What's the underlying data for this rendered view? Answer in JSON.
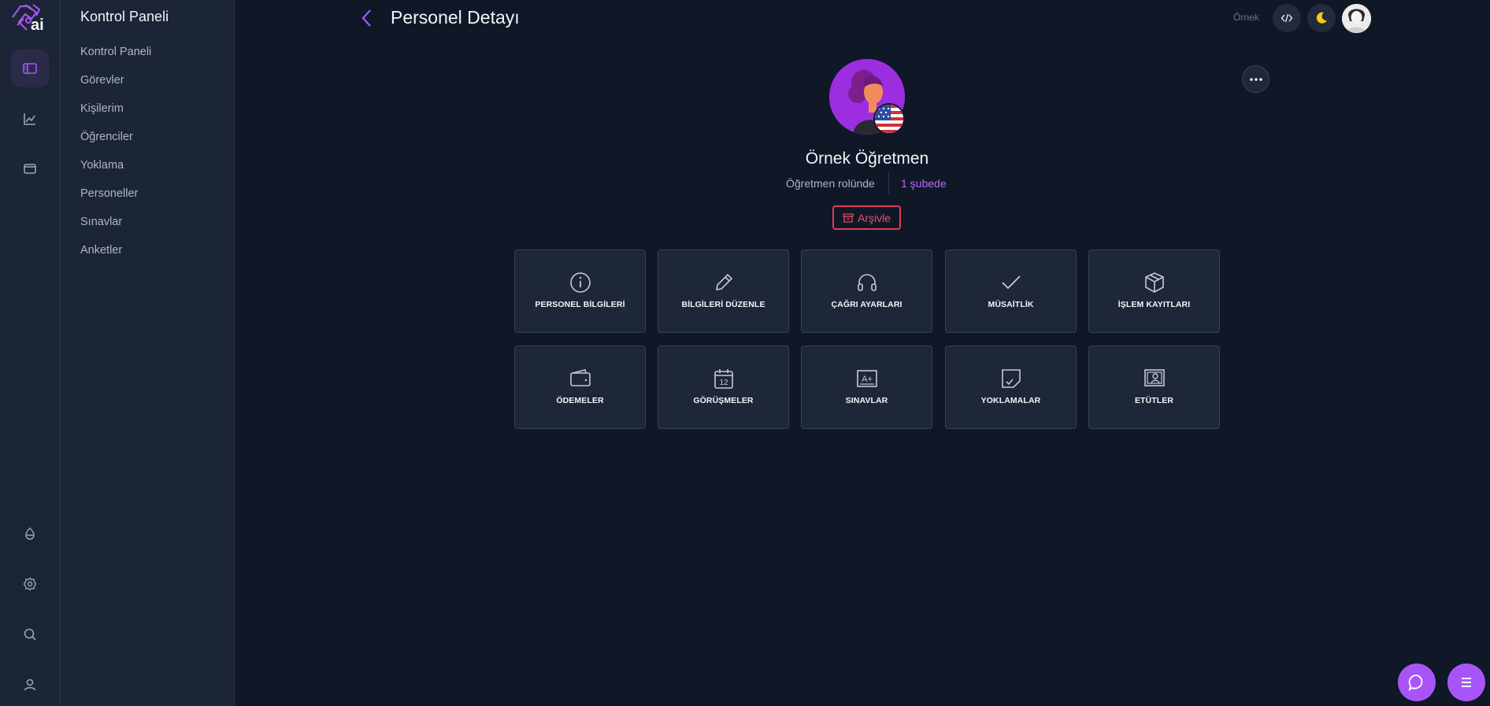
{
  "sidebar": {
    "title": "Kontrol Paneli",
    "items": [
      {
        "label": "Kontrol Paneli"
      },
      {
        "label": "Görevler"
      },
      {
        "label": "Kişilerim"
      },
      {
        "label": "Öğrenciler"
      },
      {
        "label": "Yoklama"
      },
      {
        "label": "Personeller"
      },
      {
        "label": "Sınavlar"
      },
      {
        "label": "Anketler"
      }
    ]
  },
  "rail": {
    "logo_text": "ai",
    "top_icons": [
      "sidebar-panel-icon",
      "chart-icon",
      "wallet-icon"
    ],
    "bottom_icons": [
      "theme-drop-icon",
      "settings-icon",
      "search-icon",
      "user-icon"
    ]
  },
  "header": {
    "title": "Personel Detayı",
    "user_name": "Örnek",
    "icons": [
      "code-icon",
      "moon-icon"
    ]
  },
  "profile": {
    "name": "Örnek Öğretmen",
    "role": "Öğretmen rolünde",
    "branch": "1 şubede",
    "archive_label": "Arşivle"
  },
  "cards": [
    {
      "label": "PERSONEL BİLGİLERİ",
      "icon": "info-icon"
    },
    {
      "label": "BİLGİLERİ DÜZENLE",
      "icon": "pencil-icon"
    },
    {
      "label": "ÇAĞRI AYARLARI",
      "icon": "headset-icon"
    },
    {
      "label": "MÜSAİTLİK",
      "icon": "check-icon"
    },
    {
      "label": "İŞLEM KAYITLARI",
      "icon": "box-icon"
    },
    {
      "label": "ÖDEMELER",
      "icon": "wallet-icon"
    },
    {
      "label": "GÖRÜŞMELER",
      "icon": "calendar-icon"
    },
    {
      "label": "SINAVLAR",
      "icon": "exam-icon"
    },
    {
      "label": "YOKLAMALAR",
      "icon": "attendance-icon"
    },
    {
      "label": "ETÜTLER",
      "icon": "study-icon"
    }
  ],
  "calendar_day": "12",
  "exam_grade": "A+",
  "colors": {
    "background": "#101828",
    "panel": "#1c2536",
    "accent": "#a855f7",
    "danger": "#e13c52",
    "warning": "#facc15"
  }
}
